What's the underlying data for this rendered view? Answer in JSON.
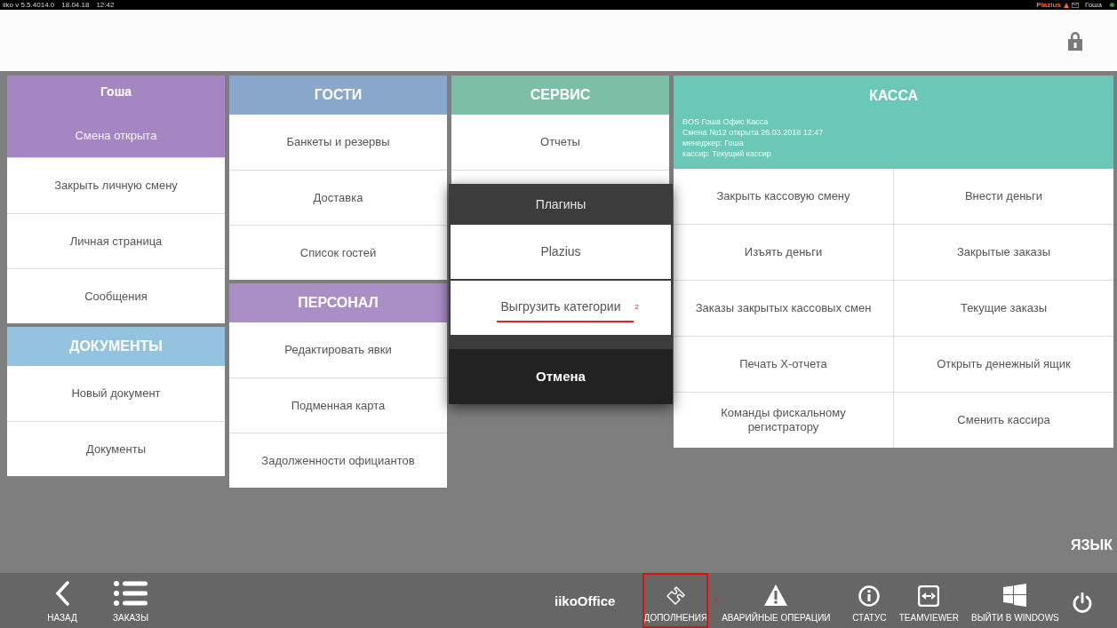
{
  "top_bar": {
    "version": "iiko v 5.5.4014.0",
    "date": "18.04.18",
    "time": "12:42",
    "plugin": "Plazius",
    "user": "Гоша",
    "online": true
  },
  "columns": [
    {
      "sections": [
        {
          "title": "Гоша",
          "color": "#a586c2",
          "subtitle": "Смена открыта",
          "items": [
            "Закрыть личную смену",
            "Личная страница",
            "Сообщения"
          ]
        },
        {
          "title": "ДОКУМЕНТЫ",
          "color": "#94c3df",
          "items": [
            "Новый документ",
            "Документы"
          ]
        }
      ]
    },
    {
      "sections": [
        {
          "title": "ГОСТИ",
          "color": "#89a8cb",
          "items": [
            "Банкеты и резервы",
            "Доставка",
            "Список гостей"
          ]
        },
        {
          "title": "ПЕРСОНАЛ",
          "color": "#aa8ec6",
          "items": [
            "Редактировать явки",
            "Подменная карта",
            "Задолженности официантов"
          ]
        }
      ]
    },
    {
      "sections": [
        {
          "title": "СЕРВИС",
          "color": "#7cbfa6",
          "items": [
            "Отчеты"
          ]
        }
      ]
    }
  ],
  "kassa": {
    "title": "КАССА",
    "color": "#6cc8b6",
    "info": [
      "BOS Гоша Офис Касса",
      "Смена №12 открыта 26.03.2018 12:47",
      "менеджер: Гоша",
      "кассир: Текущий кассир"
    ],
    "buttons": [
      "Закрыть кассовую смену",
      "Внести деньги",
      "Изъять деньги",
      "Закрытые заказы",
      "Заказы закрытых кассовых смен",
      "Текущие заказы",
      "Печать X-отчета",
      "Открыть денежный ящик",
      "Команды фискальному регистратору",
      "Сменить кассира"
    ]
  },
  "dialog": {
    "title": "Плагины",
    "items": [
      {
        "label": "Plazius"
      },
      {
        "label": "Выгрузить категории",
        "annotation": "2"
      }
    ],
    "cancel": "Отмена"
  },
  "language": "ЯЗЫК",
  "bottom_bar": {
    "left": [
      "НАЗАД",
      "ЗАКАЗЫ"
    ],
    "brand": "iikoOffice",
    "right": [
      {
        "label": "ДОПОЛНЕНИЯ",
        "annotation": "1"
      },
      {
        "label": "АВАРИЙНЫЕ ОПЕРАЦИИ"
      },
      {
        "label": "СТАТУС"
      },
      {
        "label": "TEAMVIEWER"
      },
      {
        "label": "ВЫЙТИ В WINDOWS"
      }
    ]
  }
}
